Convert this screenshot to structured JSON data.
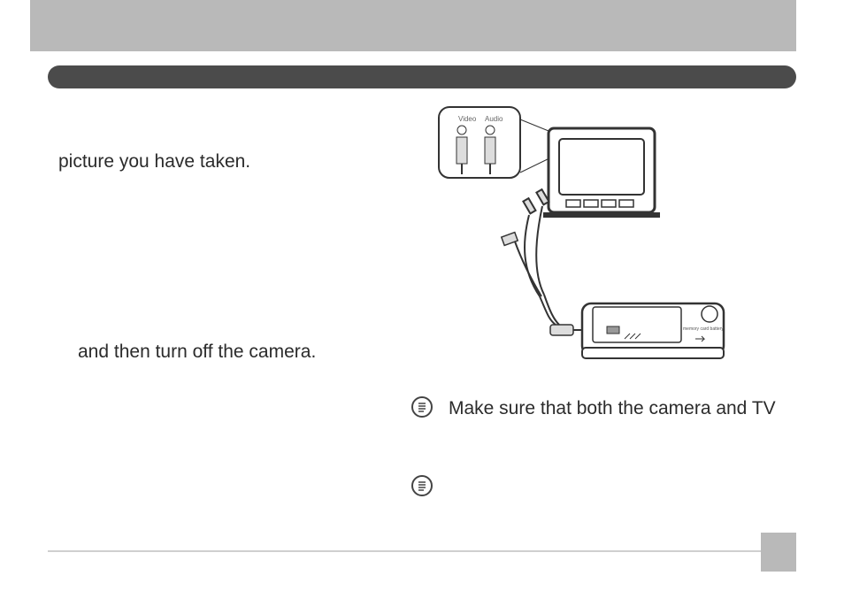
{
  "page": {
    "title_bar": "",
    "section_bar": ""
  },
  "instructions": {
    "line1": "picture you have taken.",
    "line2": "and then turn off the camera."
  },
  "notes": {
    "note1": "Make sure that both the camera and TV",
    "note2": ""
  },
  "diagram": {
    "connector_labels": {
      "left": "Video",
      "right": "Audio"
    },
    "camera_label": "memory card battery"
  },
  "icons": {
    "note": "note-icon"
  }
}
